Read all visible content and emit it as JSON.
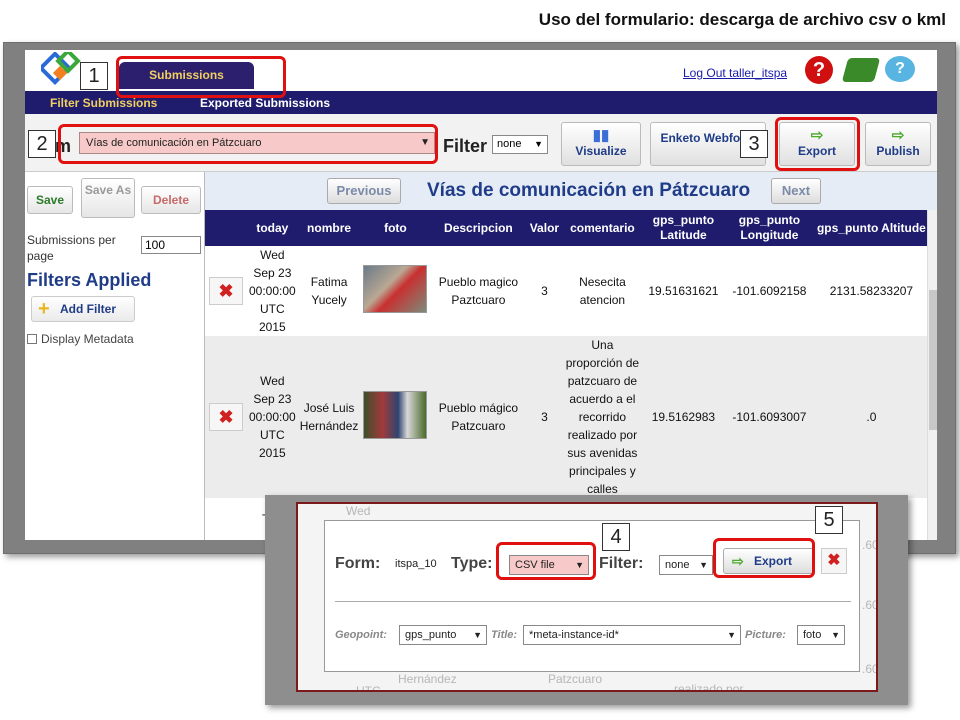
{
  "slide_title": "Uso del formulario: descarga de archivo csv o kml",
  "header": {
    "tab_submissions": "Submissions",
    "logout": "Log Out taller_itspa"
  },
  "nav": {
    "filter_submissions": "Filter Submissions",
    "exported_submissions": "Exported Submissions"
  },
  "form_row": {
    "form_label": "Form:",
    "form_value": "Vías de comunicación en Pátzcuaro",
    "filter_label": "Filter",
    "filter_value": "none",
    "visualize": "Visualize",
    "enketo": "Enketo Webform",
    "export": "Export",
    "publish": "Publish"
  },
  "left_panel": {
    "save": "Save",
    "save_as": "Save As",
    "delete": "Delete",
    "submissions_per_page": "Submissions per page",
    "per_page_value": "100",
    "filters_applied": "Filters Applied",
    "add_filter": "Add Filter",
    "display_metadata": "Display Metadata"
  },
  "pager": {
    "previous": "Previous",
    "title": "Vías de comunicación en Pátzcuaro",
    "next": "Next"
  },
  "table": {
    "headers": [
      "today",
      "nombre",
      "foto",
      "Descripcion",
      "Valor",
      "comentario",
      "gps_punto Latitude",
      "gps_punto Longitude",
      "gps_punto Altitude"
    ],
    "rows": [
      {
        "today": "Wed Sep 23 00:00:00 UTC 2015",
        "nombre": "Fatima Yucely",
        "descripcion": "Pueblo magico Paztcuaro",
        "valor": "3",
        "comentario": "Nesecita atencion",
        "lat": "19.51631621",
        "lon": "-101.6092158",
        "alt": "2131.58233207"
      },
      {
        "today": "Wed Sep 23 00:00:00 UTC 2015",
        "nombre": "José Luis Hernández",
        "descripcion": "Pueblo mágico Patzcuaro",
        "valor": "3",
        "comentario": "Una proporción de patzcuaro de acuerdo a el recorrido realizado por sus avenidas principales y calles",
        "lat": "19.5162983",
        "lon": "-101.6093007",
        "alt": ".0"
      }
    ],
    "partial_row_start": "Thu"
  },
  "callouts": [
    "1",
    "2",
    "3",
    "4",
    "5"
  ],
  "export_dialog": {
    "form_label": "Form:",
    "form_value": "itspa_10",
    "type_label": "Type:",
    "type_value": "CSV file",
    "filter_label": "Filter:",
    "filter_value": "none",
    "export": "Export",
    "geopoint_label": "Geopoint:",
    "geopoint_value": "gps_punto",
    "title_label": "Title:",
    "title_value": "*meta-instance-id*",
    "picture_label": "Picture:",
    "picture_value": "foto",
    "bg_texts": [
      "Wed",
      "Hernández",
      "Patzcuaro",
      "UTC",
      "realizado por",
      ".60",
      ".60",
      ".60"
    ]
  },
  "colors": {
    "highlight": "#e01010",
    "navbar": "#1f1c6e",
    "accent_text": "#1f3c88"
  }
}
